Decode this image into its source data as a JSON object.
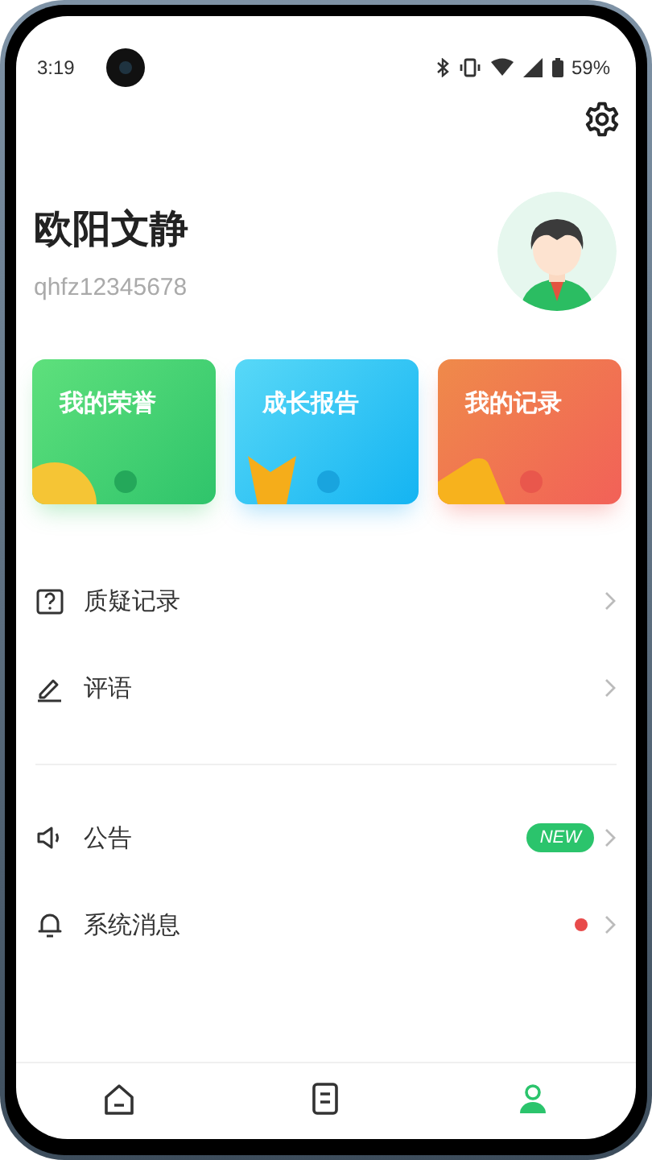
{
  "status_bar": {
    "time": "3:19",
    "battery": "59%"
  },
  "profile": {
    "name": "欧阳文静",
    "account": "qhfz12345678"
  },
  "cards": [
    {
      "title": "我的荣誉",
      "kind": "honor"
    },
    {
      "title": "成长报告",
      "kind": "report"
    },
    {
      "title": "我的记录",
      "kind": "record"
    }
  ],
  "menu_groups": [
    [
      {
        "label": "质疑记录",
        "kind": "question",
        "unread": false
      },
      {
        "label": "评语",
        "kind": "pen",
        "unread": false
      }
    ],
    [
      {
        "label": "公告",
        "kind": "speaker",
        "badge": "NEW",
        "unread": false
      },
      {
        "label": "系统消息",
        "kind": "bell",
        "unread": true
      }
    ]
  ],
  "tabs": [
    {
      "kind": "home",
      "selected": false
    },
    {
      "kind": "list",
      "selected": false
    },
    {
      "kind": "profile",
      "selected": true
    }
  ]
}
